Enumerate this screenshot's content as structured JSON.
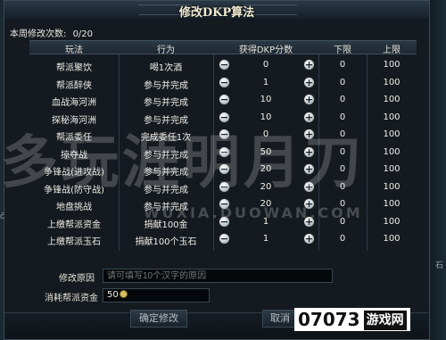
{
  "dialog": {
    "title": "修改DKP算法",
    "edit_count_label": "本周修改次数:",
    "edit_count_value": "0/20"
  },
  "table": {
    "headers": [
      "玩法",
      "行为",
      "获得DKP分数",
      "下限",
      "上限"
    ],
    "rows": [
      {
        "mode": "帮派聚饮",
        "action": "喝1次酒",
        "score": "0",
        "min": "0",
        "max": "100"
      },
      {
        "mode": "帮派醉侠",
        "action": "参与并完成",
        "score": "1",
        "min": "0",
        "max": "100"
      },
      {
        "mode": "血战海河洲",
        "action": "参与并完成",
        "score": "10",
        "min": "0",
        "max": "100"
      },
      {
        "mode": "探秘海河洲",
        "action": "参与并完成",
        "score": "10",
        "min": "0",
        "max": "100"
      },
      {
        "mode": "帮派委任",
        "action": "完成委任1次",
        "score": "0",
        "min": "0",
        "max": "100"
      },
      {
        "mode": "掠夺战",
        "action": "参与并完成",
        "score": "50",
        "min": "0",
        "max": "100"
      },
      {
        "mode": "争锋战(进攻战)",
        "action": "参与并完成",
        "score": "20",
        "min": "0",
        "max": "100"
      },
      {
        "mode": "争锋战(防守战)",
        "action": "参与并完成",
        "score": "20",
        "min": "0",
        "max": "100"
      },
      {
        "mode": "地盘挑战",
        "action": "参与并完成",
        "score": "20",
        "min": "0",
        "max": "100"
      },
      {
        "mode": "上缴帮派资金",
        "action": "捐献100金",
        "score": "1",
        "min": "0",
        "max": "100"
      },
      {
        "mode": "上缴帮派玉石",
        "action": "捐献100个玉石",
        "score": "1",
        "min": "0",
        "max": "100"
      }
    ],
    "minus_symbol": "−",
    "plus_symbol": "+"
  },
  "form": {
    "reason_label": "修改原因",
    "reason_placeholder": "请可填写10个汉字的原因",
    "cost_label": "消耗帮派资金",
    "cost_value": "50"
  },
  "buttons": {
    "confirm": "确定修改",
    "cancel": "取消"
  },
  "watermark": {
    "brand": "多玩涯明月刀",
    "url": "WUXIA.DUOWAN.COM"
  },
  "logo": {
    "number": "07073",
    "text": "游戏网"
  },
  "side": {
    "left_fragment": "ĉ",
    "right_fragment": "石"
  }
}
